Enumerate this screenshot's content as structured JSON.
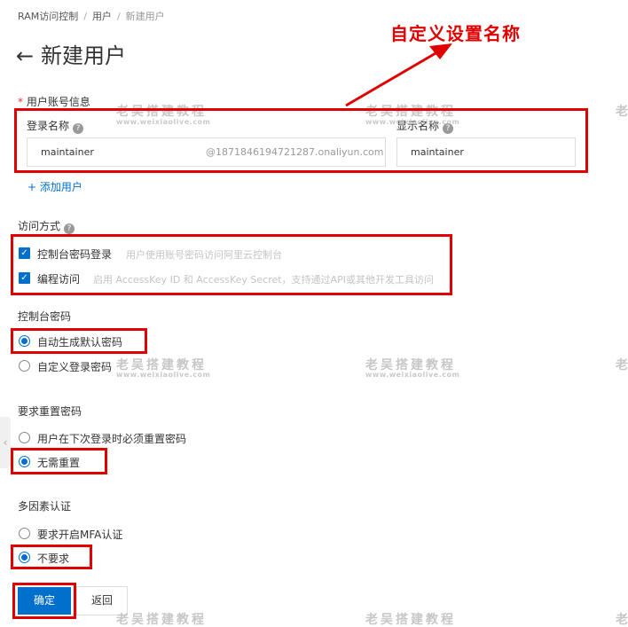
{
  "breadcrumb": {
    "item1": "RAM访问控制",
    "sep": "/",
    "item2": "用户",
    "item3": "新建用户"
  },
  "header": {
    "back_icon": "←",
    "title": "新建用户"
  },
  "callout": {
    "text": "自定义设置名称"
  },
  "account_info": {
    "required_mark": "*",
    "label": "用户账号信息",
    "login_name_label": "登录名称",
    "display_name_label": "显示名称",
    "help_glyph": "?",
    "login_name_value": "maintainer",
    "domain_suffix": "@1871846194721287.onaliyun.com",
    "display_name_value": "maintainer",
    "add_user": "+ 添加用户"
  },
  "access_mode": {
    "label": "访问方式",
    "check_glyph": "✓",
    "options": [
      {
        "label": "控制台密码登录",
        "hint": "用户使用账号密码访问阿里云控制台",
        "checked": true
      },
      {
        "label": "编程访问",
        "hint": "启用 AccessKey ID 和 AccessKey Secret，支持通过API或其他开发工具访问",
        "checked": true
      }
    ]
  },
  "console_password": {
    "label": "控制台密码",
    "options": [
      {
        "label": "自动生成默认密码",
        "selected": true
      },
      {
        "label": "自定义登录密码",
        "selected": false
      }
    ]
  },
  "reset_password": {
    "label": "要求重置密码",
    "options": [
      {
        "label": "用户在下次登录时必须重置密码",
        "selected": false
      },
      {
        "label": "无需重置",
        "selected": true
      }
    ]
  },
  "mfa": {
    "label": "多因素认证",
    "options": [
      {
        "label": "要求开启MFA认证",
        "selected": false
      },
      {
        "label": "不要求",
        "selected": true
      }
    ]
  },
  "buttons": {
    "confirm": "确定",
    "back": "返回"
  },
  "side_tab_glyph": "‹",
  "watermark": {
    "title": "老吴搭建教程",
    "title_partial": "老",
    "url": "www.weixiaolive.com"
  },
  "colors": {
    "accent": "#0070cc",
    "annotation_red": "#e00000"
  },
  "icons": {
    "back": "arrow-left-icon",
    "help": "question-circle-icon",
    "check": "checkbox-checked-icon",
    "plus": "plus-icon"
  }
}
